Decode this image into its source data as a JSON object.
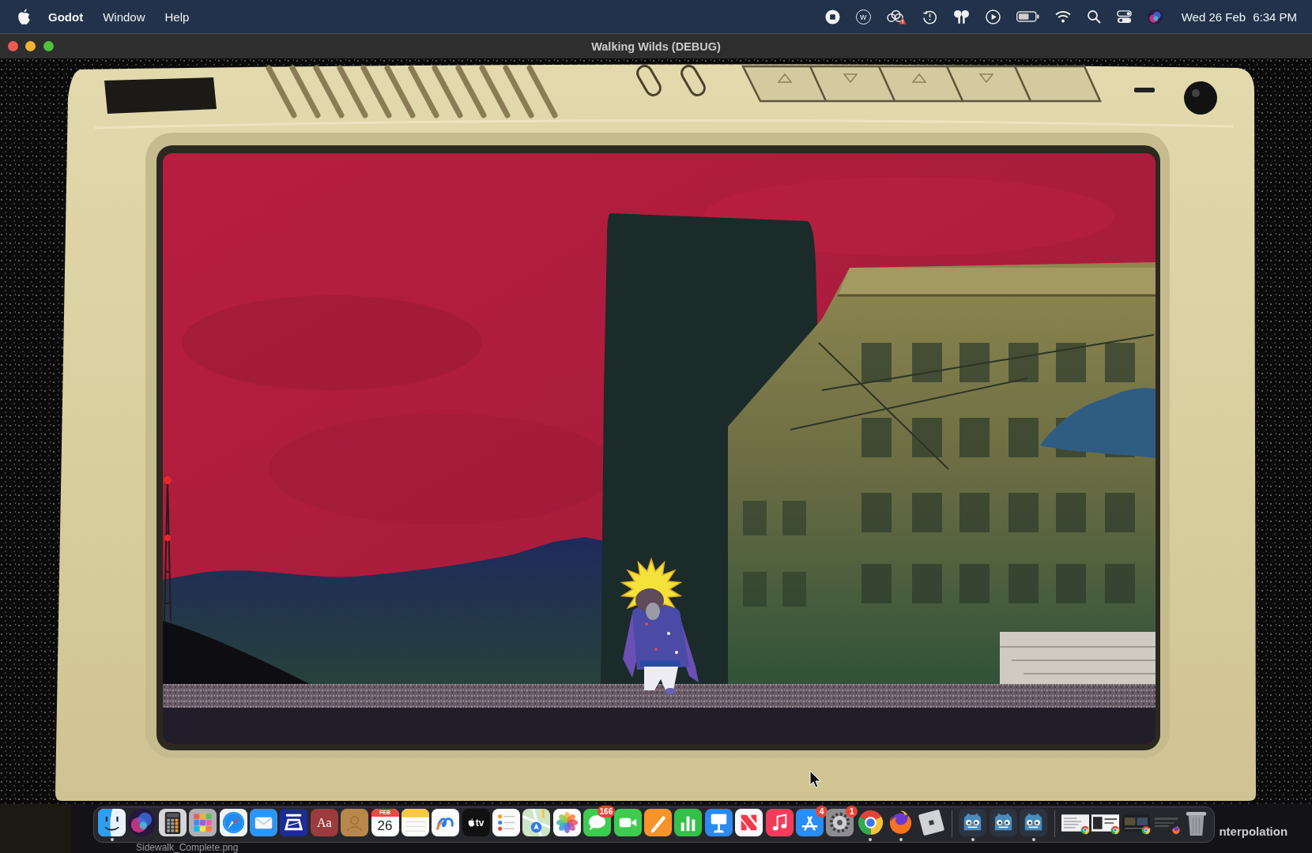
{
  "menubar": {
    "menus": [
      {
        "label": "Godot",
        "kind": "app"
      },
      {
        "label": "Window",
        "kind": "menu"
      },
      {
        "label": "Help",
        "kind": "menu"
      }
    ],
    "status_letter": "w",
    "date": "Wed 26 Feb",
    "time": "6:34 PM"
  },
  "window": {
    "title": "Walking Wilds (DEBUG)"
  },
  "dock": {
    "apps": [
      {
        "kind": "finder",
        "running": true
      },
      {
        "kind": "siri",
        "running": false
      },
      {
        "kind": "calculator",
        "running": false
      },
      {
        "kind": "launchpad",
        "running": false
      },
      {
        "kind": "safari",
        "running": false
      },
      {
        "kind": "mail",
        "running": false
      },
      {
        "kind": "scanner",
        "running": false
      },
      {
        "kind": "dictionary",
        "label": "Aa",
        "running": false
      },
      {
        "kind": "contacts",
        "running": false
      },
      {
        "kind": "calendar",
        "month": "FEB",
        "day": "26",
        "running": false
      },
      {
        "kind": "notes",
        "running": false
      },
      {
        "kind": "freeform",
        "running": false
      },
      {
        "kind": "tv",
        "label": "tv",
        "running": false
      },
      {
        "kind": "reminders",
        "running": false
      },
      {
        "kind": "maps",
        "running": false
      },
      {
        "kind": "photos",
        "running": false
      },
      {
        "kind": "messages",
        "badge": "166",
        "running": false
      },
      {
        "kind": "facetime",
        "running": false
      },
      {
        "kind": "pages",
        "running": false
      },
      {
        "kind": "numbers",
        "running": false
      },
      {
        "kind": "keynote",
        "running": false
      },
      {
        "kind": "news",
        "running": false
      },
      {
        "kind": "music",
        "running": false
      },
      {
        "kind": "appstore",
        "badge": "4",
        "running": false
      },
      {
        "kind": "settings",
        "badge": "1",
        "running": false
      },
      {
        "kind": "chrome",
        "running": true
      },
      {
        "kind": "firefox",
        "running": true
      },
      {
        "kind": "roblox",
        "running": false
      }
    ],
    "recent": [
      {
        "kind": "godot",
        "running": true
      },
      {
        "kind": "godot",
        "running": false
      },
      {
        "kind": "godot",
        "running": true
      }
    ],
    "minimized": [
      {
        "kind": "chrome"
      },
      {
        "kind": "chrome"
      },
      {
        "kind": "chrome"
      },
      {
        "kind": "firefox"
      }
    ]
  },
  "desktop": {
    "file_name": "Sidewalk_Complete.png",
    "partial_label": "nterpolation"
  }
}
